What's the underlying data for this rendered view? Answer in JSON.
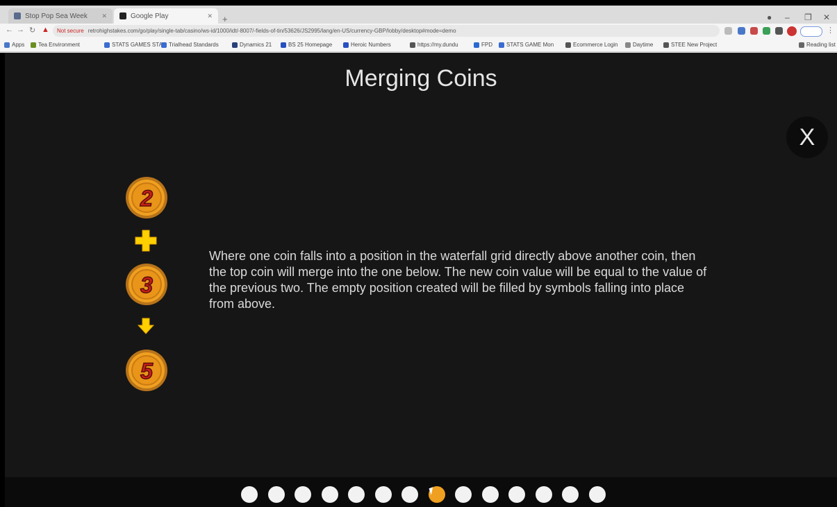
{
  "browser": {
    "tabs": [
      {
        "label": "Stop Pop Sea Week",
        "favicon_color": "#5a6b8c"
      },
      {
        "label": "Google Play",
        "favicon_color": "#222222"
      }
    ],
    "new_tab": "+",
    "security_label": "Not secure",
    "url": "retrohighstakes.com/go/play/single-tab/casino/ws-id/1000/idt/-8007/-fields-of-tin/53626/JS2995/lang/en-US/currency-GBP/lobby/desktop#mode=demo",
    "bookmarks": [
      "Apps",
      "Tea Environment",
      "STATS GAMES STA",
      "Trialhead Standards",
      "Dynamics 21",
      "BS 25 Homepage",
      "Heroic Numbers",
      "https://my.dundu",
      "FPD",
      "STATS GAME Mon",
      "Ecommerce Login",
      "Daytime",
      "STEE New Project",
      "Reading list"
    ],
    "window_controls": [
      "–",
      "❐",
      "✕"
    ]
  },
  "game": {
    "title": "Merging Coins",
    "close_label": "X",
    "coins": [
      {
        "value": "2"
      },
      {
        "value": "3"
      },
      {
        "value": "5"
      }
    ],
    "description": "Where one coin falls into a position in the waterfall grid directly above another coin, then the top coin will merge into the one below. The new coin value will be equal to the value of the previous two. The empty position created will be filled by symbols falling into place from above.",
    "pages": {
      "count": 14,
      "active_index": 7
    },
    "colors": {
      "background": "#161616",
      "coin_gold": "#f0a020",
      "coin_number": "#c8201a",
      "plus_yellow": "#ffd000",
      "dot": "#f2f2f2",
      "dot_active": "#f0a020"
    }
  }
}
